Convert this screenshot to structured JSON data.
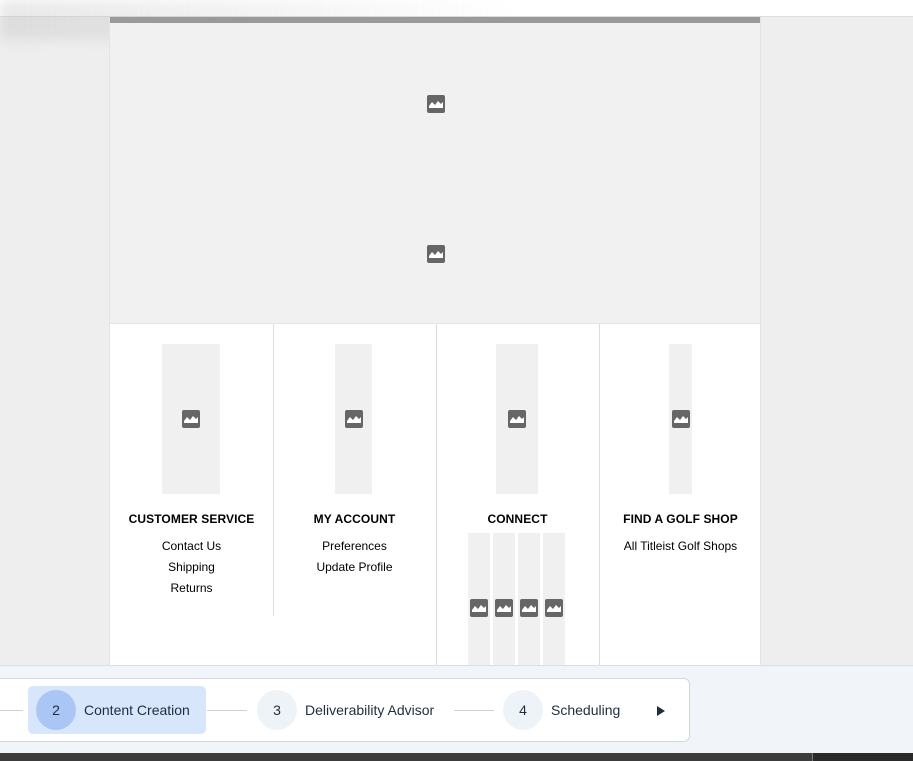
{
  "footer": {
    "columns": [
      {
        "title": "CUSTOMER SERVICE",
        "links": [
          "Contact Us",
          "Shipping",
          "Returns"
        ]
      },
      {
        "title": "MY ACCOUNT",
        "links": [
          "Preferences",
          "Update Profile"
        ]
      },
      {
        "title": "CONNECT",
        "links": []
      },
      {
        "title": "FIND A GOLF SHOP",
        "links": [
          "All Titleist Golf Shops"
        ]
      }
    ]
  },
  "stepper": {
    "steps": [
      {
        "number": "2",
        "label": "Content Creation",
        "active": true
      },
      {
        "number": "3",
        "label": "Deliverability Advisor",
        "active": false
      },
      {
        "number": "4",
        "label": "Scheduling",
        "active": false
      }
    ]
  },
  "colors": {
    "active_step_bg": "#d7e6fb",
    "active_step_circle": "#aac6f4",
    "step_text": "#1f2d3d"
  },
  "icons": {
    "broken_image": "broken-image-icon",
    "next": "chevron-right-icon"
  }
}
